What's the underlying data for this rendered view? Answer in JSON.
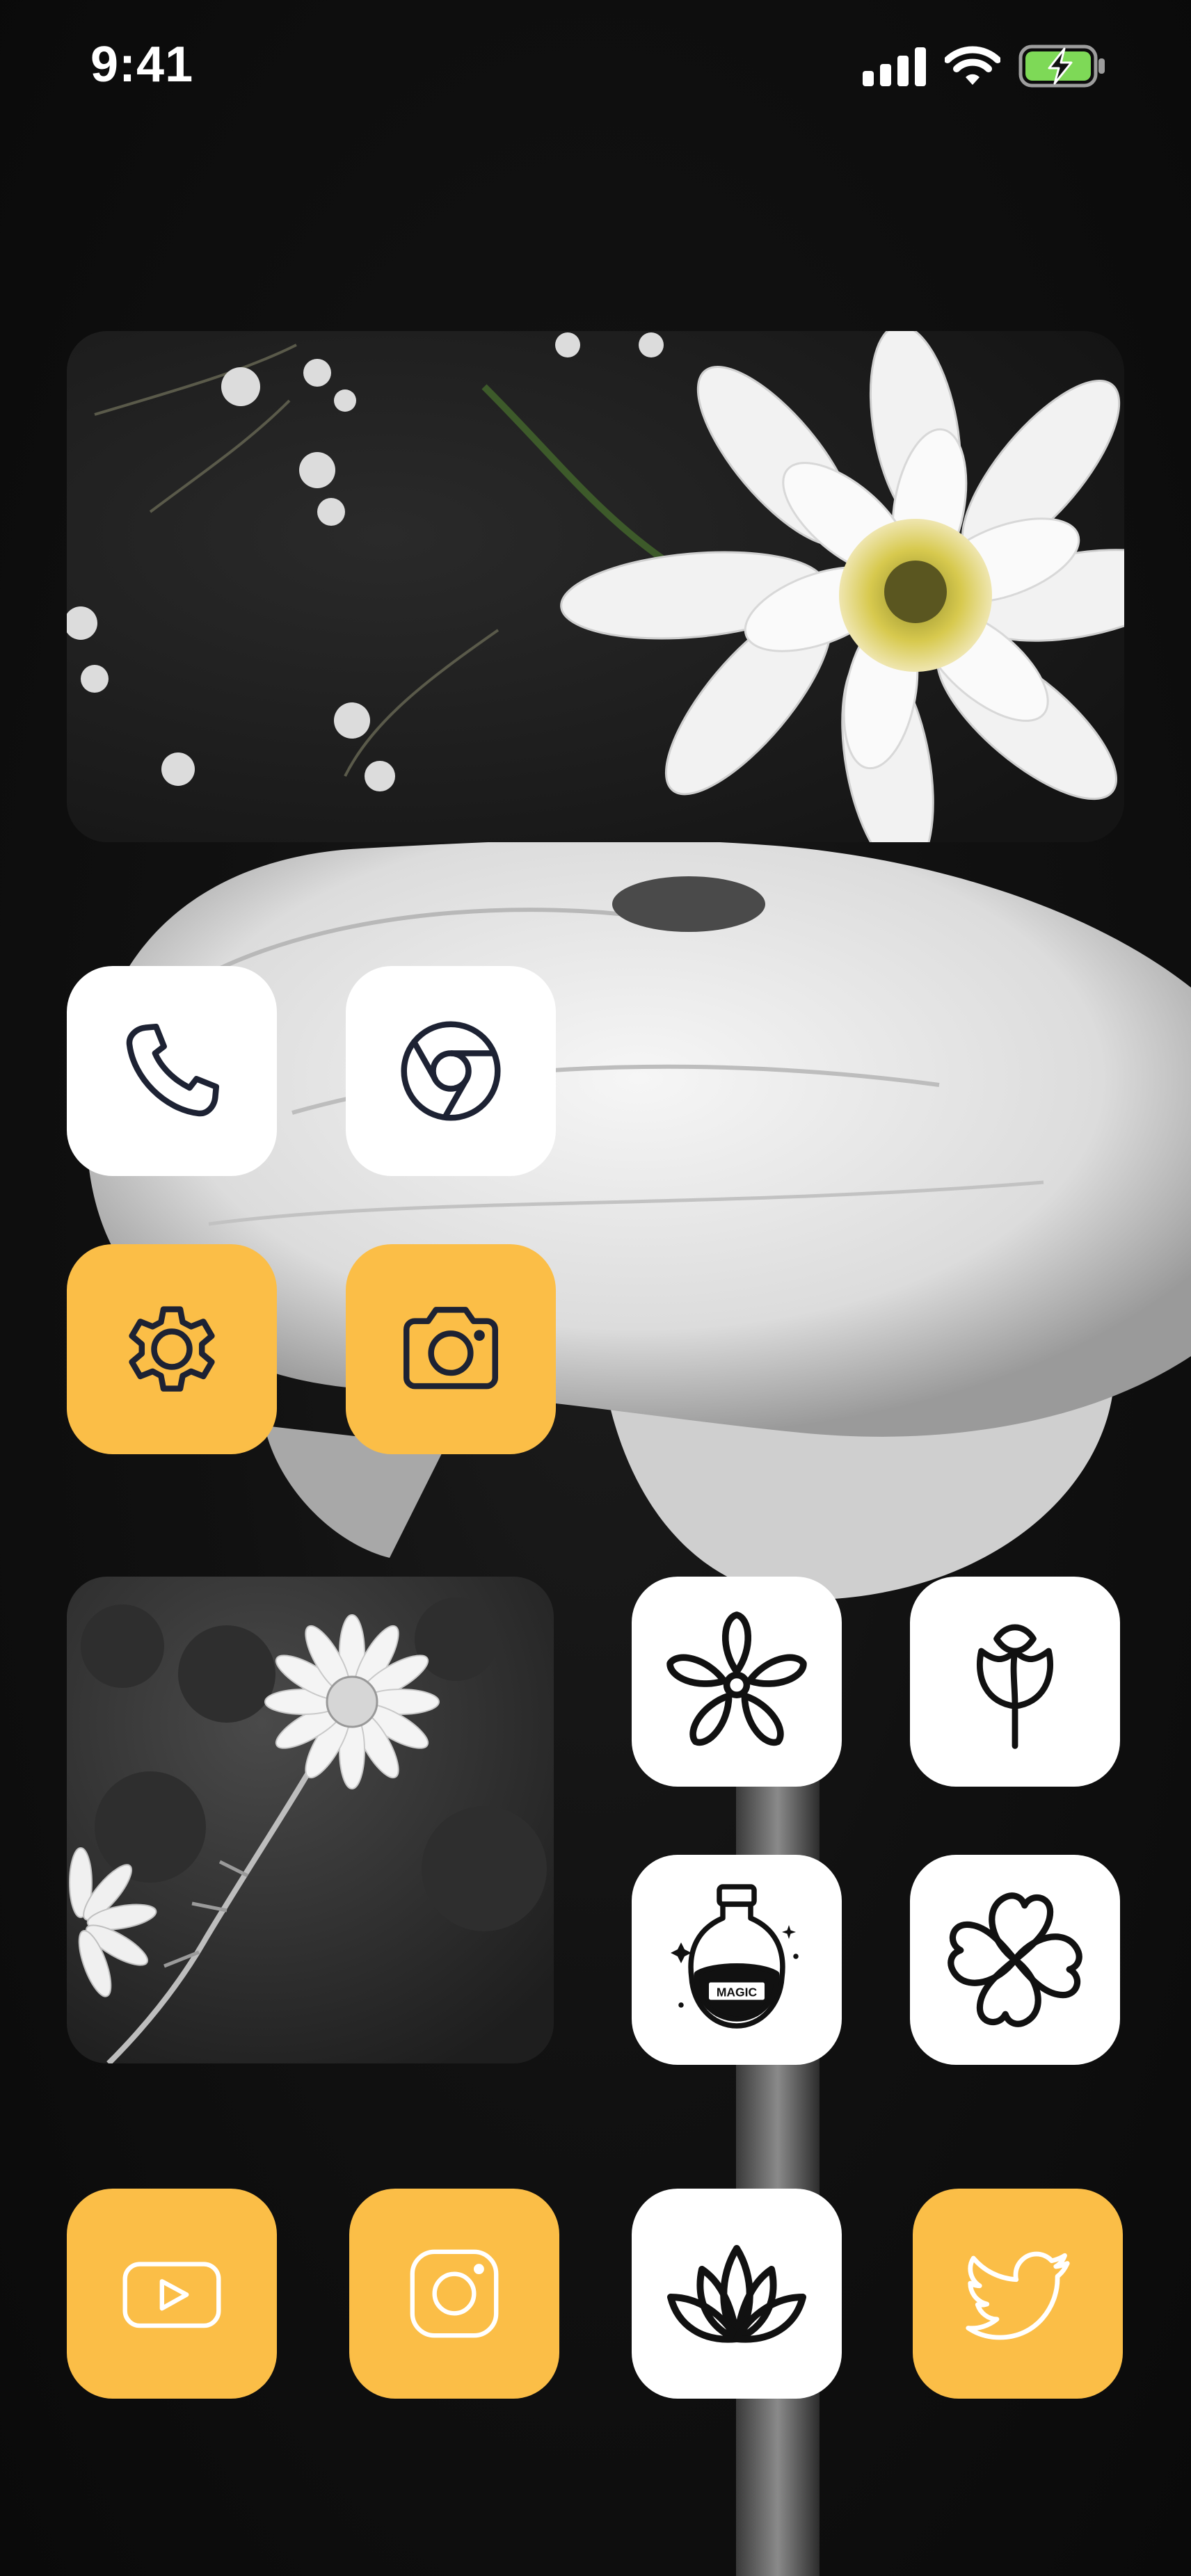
{
  "status_bar": {
    "time": "9:41",
    "signal_icon": "cellular-signal-icon",
    "wifi_icon": "wifi-icon",
    "battery_icon": "battery-charging-icon",
    "battery_color": "#7ed957"
  },
  "widgets": {
    "top_photo": "white-chrysanthemum-photo",
    "square_photo": "daisy-photo"
  },
  "apps": [
    {
      "id": "phone",
      "icon": "phone-icon",
      "tile_color": "#ffffff"
    },
    {
      "id": "chrome",
      "icon": "chrome-icon",
      "tile_color": "#ffffff"
    },
    {
      "id": "settings",
      "icon": "gear-icon",
      "tile_color": "#fbbe47"
    },
    {
      "id": "camera",
      "icon": "camera-icon",
      "tile_color": "#fbbe47"
    },
    {
      "id": "flower",
      "icon": "flower-icon",
      "tile_color": "#ffffff"
    },
    {
      "id": "rose",
      "icon": "tulip-icon",
      "tile_color": "#ffffff"
    },
    {
      "id": "magic",
      "icon": "potion-bottle-icon",
      "tile_color": "#ffffff",
      "label": "MAGIC"
    },
    {
      "id": "clover",
      "icon": "clover-icon",
      "tile_color": "#ffffff"
    },
    {
      "id": "youtube",
      "icon": "youtube-icon",
      "tile_color": "#fbbe47"
    },
    {
      "id": "instagram",
      "icon": "instagram-icon",
      "tile_color": "#fbbe47"
    },
    {
      "id": "lotus",
      "icon": "lotus-icon",
      "tile_color": "#ffffff"
    },
    {
      "id": "twitter",
      "icon": "twitter-bird-icon",
      "tile_color": "#fbbe47"
    }
  ],
  "colors": {
    "accent_yellow": "#fbbe47",
    "tile_white": "#ffffff",
    "icon_stroke": "#1d2233"
  }
}
